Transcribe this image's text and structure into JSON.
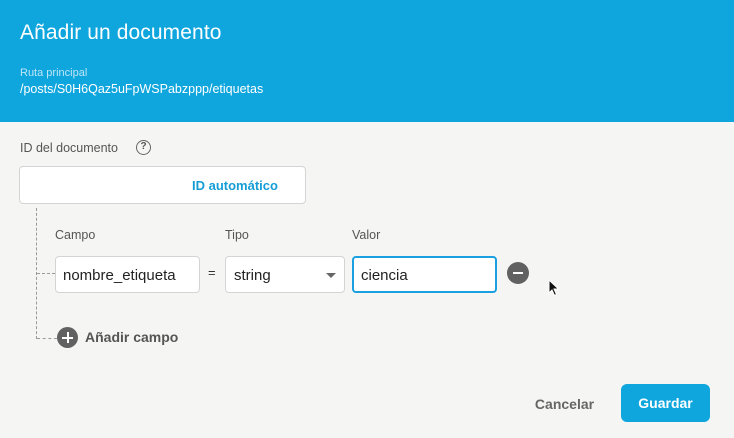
{
  "dialog": {
    "title": "Añadir un documento",
    "path_label": "Ruta principal",
    "path_value": "/posts/S0H6Qaz5uFpWSPabzppp/etiquetas"
  },
  "document_id": {
    "label": "ID del documento",
    "help_icon": "question-circle-icon",
    "auto_id_label": "ID automático"
  },
  "fields": {
    "column_labels": {
      "field": "Campo",
      "type": "Tipo",
      "value": "Valor"
    },
    "rows": [
      {
        "field": "nombre_etiqueta",
        "equals": "=",
        "type": "string",
        "value": "ciencia",
        "remove_icon": "remove-circle-icon"
      }
    ],
    "add_field_label": "Añadir campo",
    "add_icon": "add-circle-icon"
  },
  "actions": {
    "cancel_label": "Cancelar",
    "save_label": "Guardar"
  },
  "colors": {
    "accent": "#0fa5dd",
    "focus_border": "#1a9fe0",
    "icon_gray": "#616161"
  }
}
